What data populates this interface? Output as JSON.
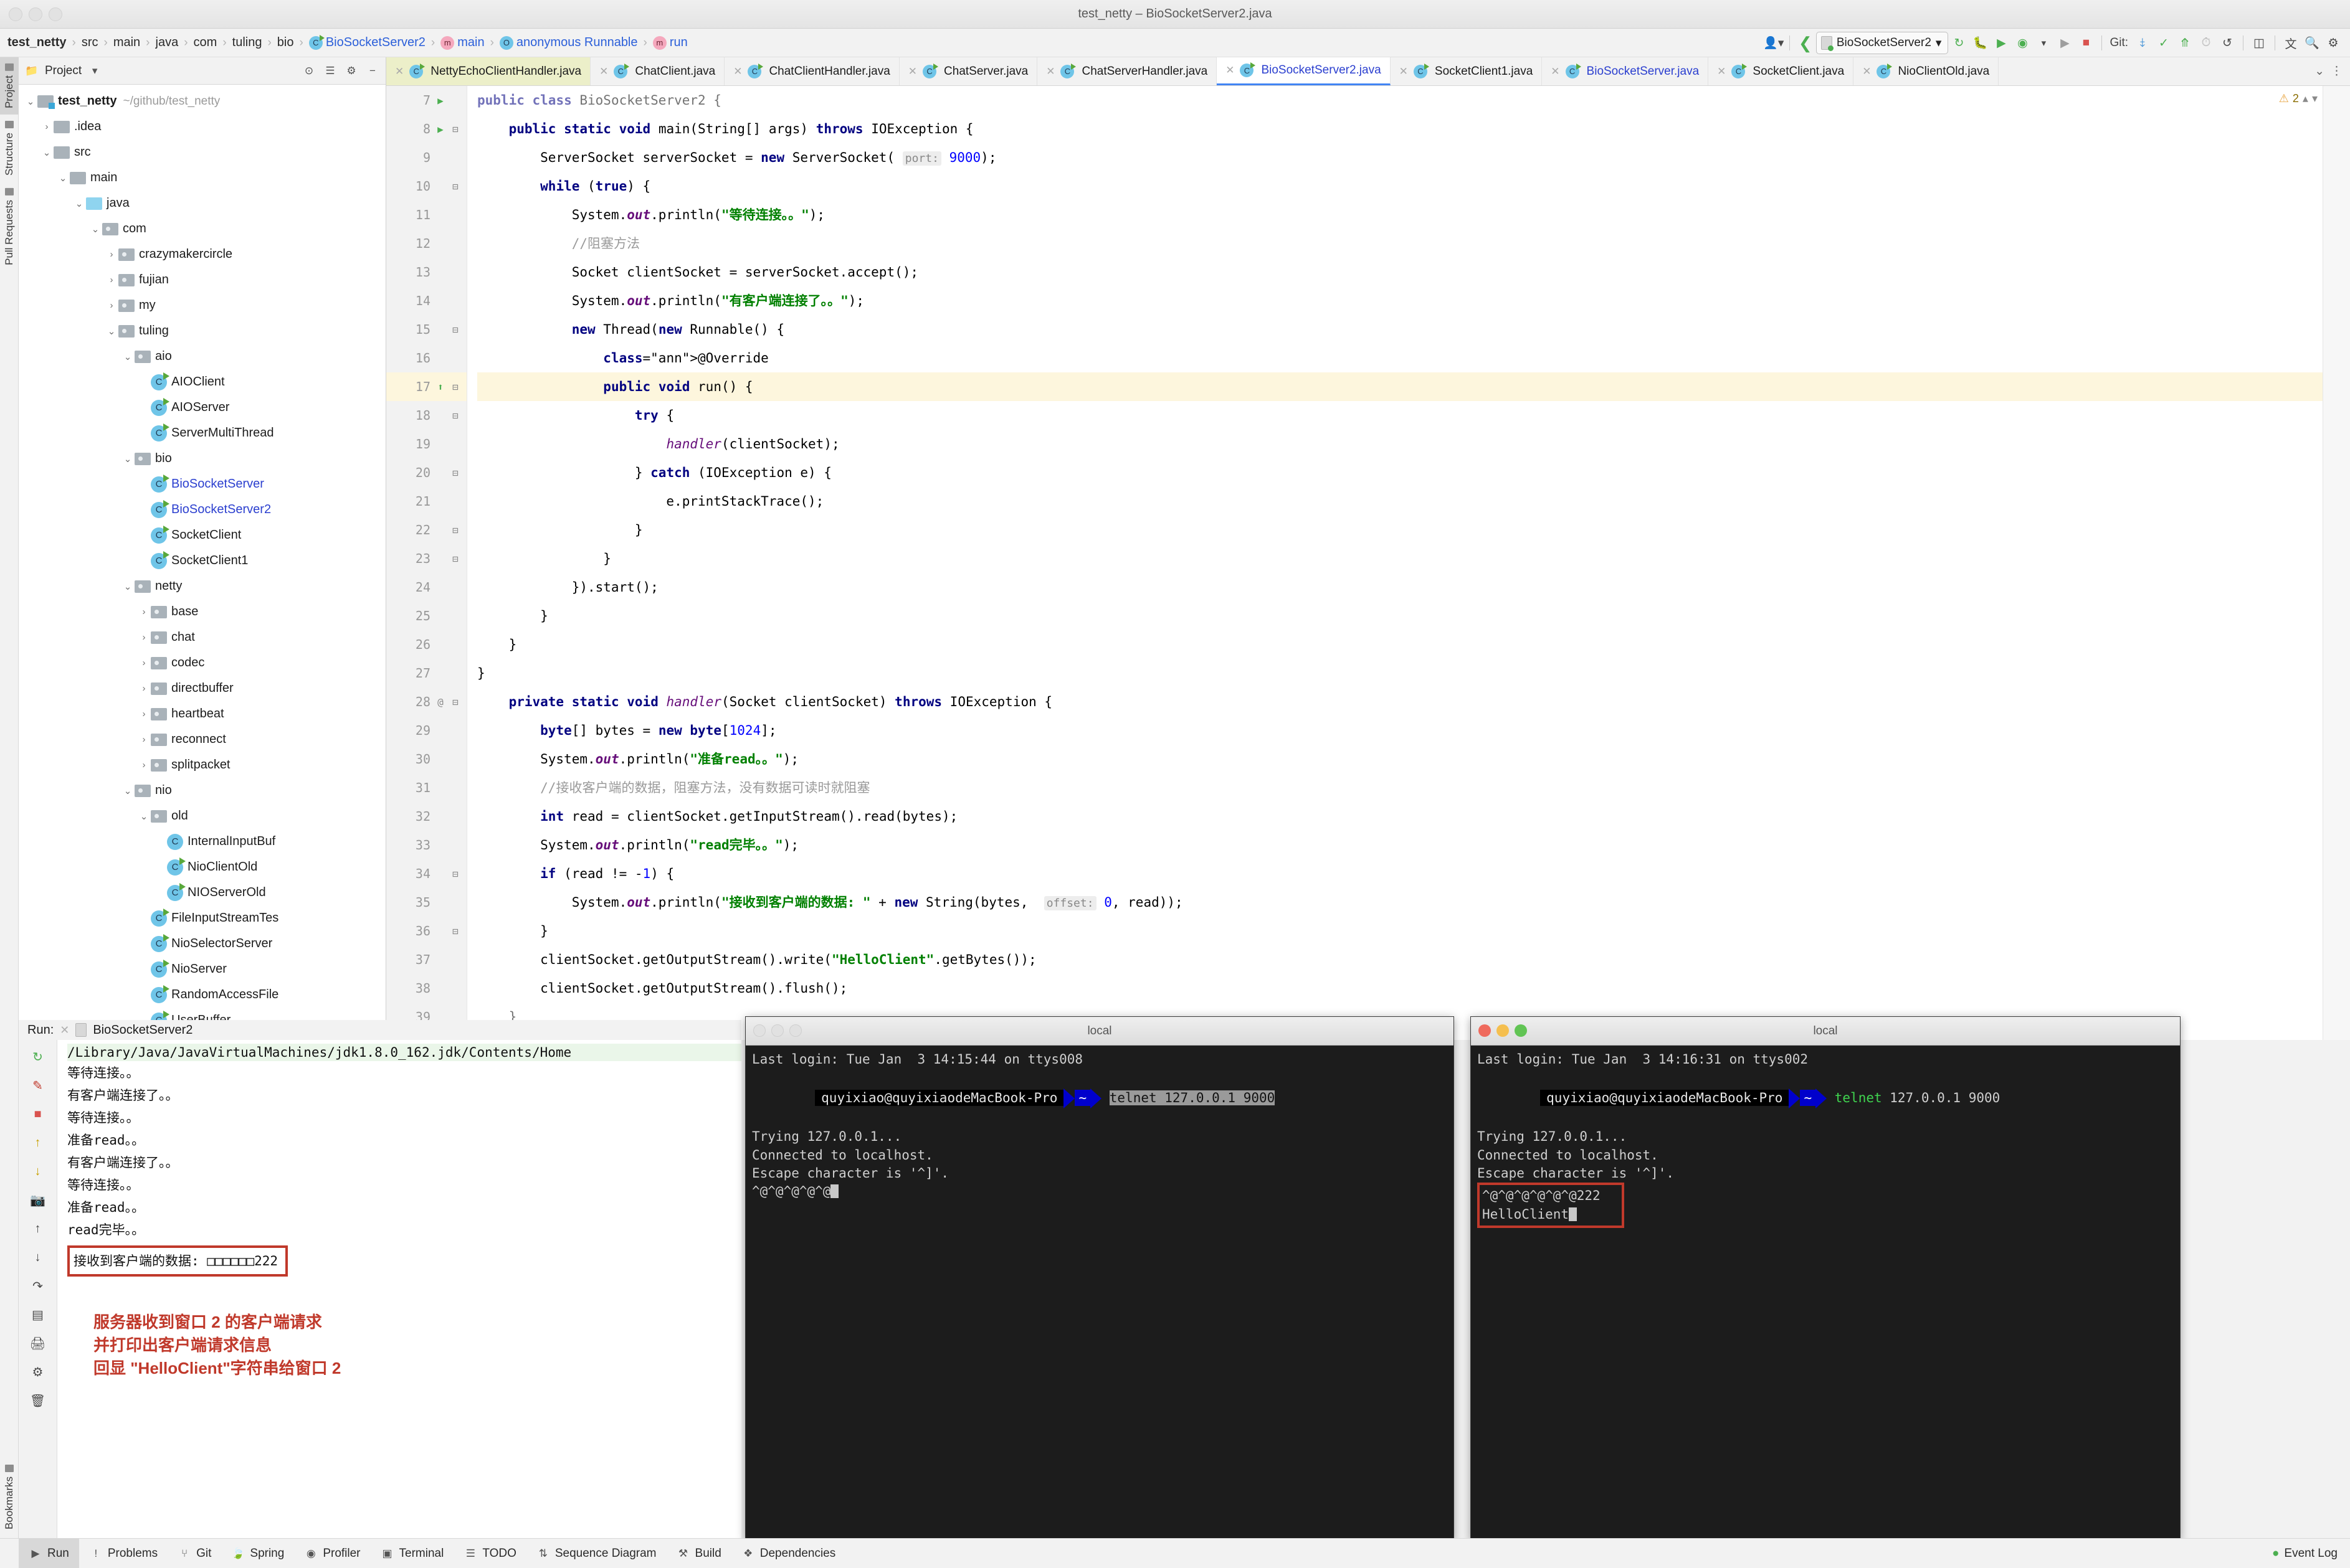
{
  "window": {
    "title": "test_netty – BioSocketServer2.java"
  },
  "breadcrumb": [
    {
      "label": "test_netty",
      "icon": "",
      "style": "bold"
    },
    {
      "label": "src",
      "icon": "",
      "style": ""
    },
    {
      "label": "main",
      "icon": "",
      "style": ""
    },
    {
      "label": "java",
      "icon": "",
      "style": ""
    },
    {
      "label": "com",
      "icon": "",
      "style": ""
    },
    {
      "label": "tuling",
      "icon": "",
      "style": ""
    },
    {
      "label": "bio",
      "icon": "",
      "style": ""
    },
    {
      "label": "BioSocketServer2",
      "icon": "class-icon",
      "style": "blue"
    },
    {
      "label": "main",
      "icon": "method-icon",
      "style": "blue"
    },
    {
      "label": "anonymous Runnable",
      "icon": "object-icon",
      "style": "blue"
    },
    {
      "label": "run",
      "icon": "method-icon",
      "style": "blue"
    }
  ],
  "toolbar": {
    "run_config": "BioSocketServer2",
    "git_label": "Git:",
    "icons": [
      "user-avatar-icon",
      "back-arrow-icon",
      "rerun-icon",
      "debug-icon",
      "coverage-icon",
      "profile-icon",
      "run-icon",
      "stop-icon",
      "git-update-icon",
      "git-commit-icon",
      "git-push-icon",
      "git-history-icon",
      "git-revert-icon",
      "diff-icon",
      "translate-icon",
      "search-icon",
      "settings-icon"
    ]
  },
  "left_strip": [
    {
      "label": "Project",
      "icon": "folder-icon",
      "active": true
    },
    {
      "label": "Structure",
      "icon": "structure-icon",
      "active": false
    },
    {
      "label": "Pull Requests",
      "icon": "pull-request-icon",
      "active": false
    }
  ],
  "bottom_left_strip": [
    {
      "label": "Bookmarks",
      "icon": "bookmark-icon"
    }
  ],
  "project_panel": {
    "title": "Project",
    "header_icons": [
      "collapse-icon",
      "expand-icon",
      "settings-icon",
      "minimize-icon"
    ],
    "tree": [
      {
        "depth": 0,
        "arrow": "down",
        "icon": "module-icon",
        "label": "test_netty",
        "path": "~/github/test_netty",
        "style": "bold"
      },
      {
        "depth": 1,
        "arrow": "right",
        "icon": "folder-icon",
        "label": ".idea",
        "path": "",
        "style": ""
      },
      {
        "depth": 1,
        "arrow": "down",
        "icon": "folder-icon",
        "label": "src",
        "path": "",
        "style": ""
      },
      {
        "depth": 2,
        "arrow": "down",
        "icon": "folder-icon",
        "label": "main",
        "path": "",
        "style": ""
      },
      {
        "depth": 3,
        "arrow": "down",
        "icon": "source-folder-icon",
        "label": "java",
        "path": "",
        "style": ""
      },
      {
        "depth": 4,
        "arrow": "down",
        "icon": "package-icon",
        "label": "com",
        "path": "",
        "style": ""
      },
      {
        "depth": 5,
        "arrow": "right",
        "icon": "package-icon",
        "label": "crazymakercircle",
        "path": "",
        "style": ""
      },
      {
        "depth": 5,
        "arrow": "right",
        "icon": "package-icon",
        "label": "fujian",
        "path": "",
        "style": ""
      },
      {
        "depth": 5,
        "arrow": "right",
        "icon": "package-icon",
        "label": "my",
        "path": "",
        "style": ""
      },
      {
        "depth": 5,
        "arrow": "down",
        "icon": "package-icon",
        "label": "tuling",
        "path": "",
        "style": ""
      },
      {
        "depth": 6,
        "arrow": "down",
        "icon": "package-icon",
        "label": "aio",
        "path": "",
        "style": ""
      },
      {
        "depth": 7,
        "arrow": "none",
        "icon": "class-runnable-icon",
        "label": "AIOClient",
        "path": "",
        "style": ""
      },
      {
        "depth": 7,
        "arrow": "none",
        "icon": "class-runnable-icon",
        "label": "AIOServer",
        "path": "",
        "style": ""
      },
      {
        "depth": 7,
        "arrow": "none",
        "icon": "class-runnable-icon",
        "label": "ServerMultiThread",
        "path": "",
        "style": ""
      },
      {
        "depth": 6,
        "arrow": "down",
        "icon": "package-icon",
        "label": "bio",
        "path": "",
        "style": ""
      },
      {
        "depth": 7,
        "arrow": "none",
        "icon": "class-runnable-icon",
        "label": "BioSocketServer",
        "path": "",
        "style": "blue"
      },
      {
        "depth": 7,
        "arrow": "none",
        "icon": "class-runnable-icon",
        "label": "BioSocketServer2",
        "path": "",
        "style": "blue"
      },
      {
        "depth": 7,
        "arrow": "none",
        "icon": "class-runnable-icon",
        "label": "SocketClient",
        "path": "",
        "style": ""
      },
      {
        "depth": 7,
        "arrow": "none",
        "icon": "class-runnable-icon",
        "label": "SocketClient1",
        "path": "",
        "style": ""
      },
      {
        "depth": 6,
        "arrow": "down",
        "icon": "package-icon",
        "label": "netty",
        "path": "",
        "style": ""
      },
      {
        "depth": 7,
        "arrow": "right",
        "icon": "package-icon",
        "label": "base",
        "path": "",
        "style": ""
      },
      {
        "depth": 7,
        "arrow": "right",
        "icon": "package-icon",
        "label": "chat",
        "path": "",
        "style": ""
      },
      {
        "depth": 7,
        "arrow": "right",
        "icon": "package-icon",
        "label": "codec",
        "path": "",
        "style": ""
      },
      {
        "depth": 7,
        "arrow": "right",
        "icon": "package-icon",
        "label": "directbuffer",
        "path": "",
        "style": ""
      },
      {
        "depth": 7,
        "arrow": "right",
        "icon": "package-icon",
        "label": "heartbeat",
        "path": "",
        "style": ""
      },
      {
        "depth": 7,
        "arrow": "right",
        "icon": "package-icon",
        "label": "reconnect",
        "path": "",
        "style": ""
      },
      {
        "depth": 7,
        "arrow": "right",
        "icon": "package-icon",
        "label": "splitpacket",
        "path": "",
        "style": ""
      },
      {
        "depth": 6,
        "arrow": "down",
        "icon": "package-icon",
        "label": "nio",
        "path": "",
        "style": ""
      },
      {
        "depth": 7,
        "arrow": "down",
        "icon": "package-icon",
        "label": "old",
        "path": "",
        "style": ""
      },
      {
        "depth": 8,
        "arrow": "none",
        "icon": "class-icon",
        "label": "InternalInputBuf",
        "path": "",
        "style": ""
      },
      {
        "depth": 8,
        "arrow": "none",
        "icon": "class-runnable-icon",
        "label": "NioClientOld",
        "path": "",
        "style": ""
      },
      {
        "depth": 8,
        "arrow": "none",
        "icon": "class-runnable-icon",
        "label": "NIOServerOld",
        "path": "",
        "style": ""
      },
      {
        "depth": 7,
        "arrow": "none",
        "icon": "class-runnable-icon",
        "label": "FileInputStreamTes",
        "path": "",
        "style": ""
      },
      {
        "depth": 7,
        "arrow": "none",
        "icon": "class-runnable-icon",
        "label": "NioSelectorServer",
        "path": "",
        "style": ""
      },
      {
        "depth": 7,
        "arrow": "none",
        "icon": "class-runnable-icon",
        "label": "NioServer",
        "path": "",
        "style": ""
      },
      {
        "depth": 7,
        "arrow": "none",
        "icon": "class-runnable-icon",
        "label": "RandomAccessFile",
        "path": "",
        "style": ""
      },
      {
        "depth": 7,
        "arrow": "none",
        "icon": "class-runnable-icon",
        "label": "UserBuffer",
        "path": "",
        "style": ""
      }
    ]
  },
  "editor": {
    "tabs": [
      {
        "label": "NettyEchoClientHandler.java",
        "state": "yellow",
        "icon": "class-icon"
      },
      {
        "label": "ChatClient.java",
        "state": "",
        "icon": "class-runnable-icon"
      },
      {
        "label": "ChatClientHandler.java",
        "state": "",
        "icon": "class-icon"
      },
      {
        "label": "ChatServer.java",
        "state": "",
        "icon": "class-runnable-icon"
      },
      {
        "label": "ChatServerHandler.java",
        "state": "",
        "icon": "class-icon"
      },
      {
        "label": "BioSocketServer2.java",
        "state": "active",
        "icon": "class-runnable-icon"
      },
      {
        "label": "SocketClient1.java",
        "state": "",
        "icon": "class-runnable-icon"
      },
      {
        "label": "BioSocketServer.java",
        "state": "blue",
        "icon": "class-runnable-icon"
      },
      {
        "label": "SocketClient.java",
        "state": "",
        "icon": "class-runnable-icon"
      },
      {
        "label": "NioClientOld.java",
        "state": "",
        "icon": "class-runnable-icon"
      }
    ],
    "inspection_count": "2",
    "lines": [
      {
        "n": 7,
        "marker": "run",
        "fold": "",
        "text": "public class BioSocketServer2 {",
        "partial": true
      },
      {
        "n": 8,
        "marker": "run",
        "fold": "fold",
        "text": "    public static void main(String[] args) throws IOException {"
      },
      {
        "n": 9,
        "marker": "",
        "fold": "",
        "text": "        ServerSocket serverSocket = new ServerSocket( port: 9000);"
      },
      {
        "n": 10,
        "marker": "",
        "fold": "fold",
        "text": "        while (true) {"
      },
      {
        "n": 11,
        "marker": "",
        "fold": "",
        "text": "            System.out.println(\"等待连接。。\");"
      },
      {
        "n": 12,
        "marker": "",
        "fold": "",
        "text": "            //阻塞方法"
      },
      {
        "n": 13,
        "marker": "",
        "fold": "",
        "text": "            Socket clientSocket = serverSocket.accept();"
      },
      {
        "n": 14,
        "marker": "",
        "fold": "",
        "text": "            System.out.println(\"有客户端连接了。。\");"
      },
      {
        "n": 15,
        "marker": "",
        "fold": "fold",
        "text": "            new Thread(new Runnable() {"
      },
      {
        "n": 16,
        "marker": "",
        "fold": "",
        "text": "                @Override"
      },
      {
        "n": 17,
        "marker": "impl",
        "fold": "fold",
        "text": "                public void run() {",
        "highlight": true
      },
      {
        "n": 18,
        "marker": "",
        "fold": "fold",
        "text": "                    try {"
      },
      {
        "n": 19,
        "marker": "",
        "fold": "",
        "text": "                        handler(clientSocket);"
      },
      {
        "n": 20,
        "marker": "",
        "fold": "fold",
        "text": "                    } catch (IOException e) {"
      },
      {
        "n": 21,
        "marker": "",
        "fold": "",
        "text": "                        e.printStackTrace();"
      },
      {
        "n": 22,
        "marker": "",
        "fold": "fold",
        "text": "                    }"
      },
      {
        "n": 23,
        "marker": "",
        "fold": "fold",
        "text": "                }"
      },
      {
        "n": 24,
        "marker": "",
        "fold": "",
        "text": "            }).start();"
      },
      {
        "n": 25,
        "marker": "",
        "fold": "",
        "text": "        }"
      },
      {
        "n": 26,
        "marker": "",
        "fold": "",
        "text": "    }"
      },
      {
        "n": 27,
        "marker": "",
        "fold": "",
        "text": "}"
      },
      {
        "n": 28,
        "marker": "override",
        "fold": "fold",
        "text": "    private static void handler(Socket clientSocket) throws IOException {"
      },
      {
        "n": 29,
        "marker": "",
        "fold": "",
        "text": "        byte[] bytes = new byte[1024];"
      },
      {
        "n": 30,
        "marker": "",
        "fold": "",
        "text": "        System.out.println(\"准备read。。\");"
      },
      {
        "n": 31,
        "marker": "",
        "fold": "",
        "text": "        //接收客户端的数据，阻塞方法，没有数据可读时就阻塞"
      },
      {
        "n": 32,
        "marker": "",
        "fold": "",
        "text": "        int read = clientSocket.getInputStream().read(bytes);"
      },
      {
        "n": 33,
        "marker": "",
        "fold": "",
        "text": "        System.out.println(\"read完毕。。\");"
      },
      {
        "n": 34,
        "marker": "",
        "fold": "fold",
        "text": "        if (read != -1) {"
      },
      {
        "n": 35,
        "marker": "",
        "fold": "",
        "text": "            System.out.println(\"接收到客户端的数据: \" + new String(bytes,  offset: 0, read));"
      },
      {
        "n": 36,
        "marker": "",
        "fold": "fold",
        "text": "        }"
      },
      {
        "n": 37,
        "marker": "",
        "fold": "",
        "text": "        clientSocket.getOutputStream().write(\"HelloClient\".getBytes());"
      },
      {
        "n": 38,
        "marker": "",
        "fold": "",
        "text": "        clientSocket.getOutputStream().flush();"
      },
      {
        "n": 39,
        "marker": "",
        "fold": "",
        "text": "    }",
        "partial": true
      }
    ]
  },
  "run_panel": {
    "label": "Run:",
    "config_name": "BioSocketServer2",
    "toolbar_icons": [
      "rerun-icon",
      "edit-icon",
      "stop-icon",
      "up-arrow-icon",
      "down-arrow-icon",
      "camera-icon",
      "soft-wrap-icon",
      "scroll-end-icon",
      "print-icon",
      "settings-icon",
      "trash-icon"
    ],
    "command_line": "/Library/Java/JavaVirtualMachines/jdk1.8.0_162.jdk/Contents/Home",
    "output": [
      "等待连接。。",
      "有客户端连接了。。",
      "等待连接。。",
      "准备read。。",
      "有客户端连接了。。",
      "等待连接。。",
      "准备read。。",
      "read完毕。。"
    ],
    "highlighted_output": "接收到客户端的数据: □□□□□□222",
    "annotation": [
      "服务器收到窗口 2 的客户端请求",
      "并打印出客户端请求信息",
      "回显 \"HelloClient\"字符串给窗口 2"
    ]
  },
  "terminal1": {
    "title": "local",
    "dots_style": "grey",
    "last_login": "Last login: Tue Jan  3 14:15:44 on ttys008",
    "prompt_user": "quyixiao@quyixiaodeMacBook-Pro",
    "prompt_tilde": "~",
    "command": "telnet 127.0.0.1 9000",
    "command_selected": true,
    "lines": [
      "Trying 127.0.0.1...",
      "Connected to localhost.",
      "Escape character is '^]'."
    ],
    "data_line": "^@^@^@^@^@"
  },
  "terminal2": {
    "title": "local",
    "dots_style": "color",
    "last_login": "Last login: Tue Jan  3 14:16:31 on ttys002",
    "prompt_user": "quyixiao@quyixiaodeMacBook-Pro",
    "prompt_tilde": "~",
    "command_cmd": "telnet",
    "command_args": " 127.0.0.1 9000",
    "lines": [
      "Trying 127.0.0.1...",
      "Connected to localhost.",
      "Escape character is '^]'."
    ],
    "data_line": "^@^@^@^@^@^@222",
    "reply_line": "HelloClient"
  },
  "status_bar": {
    "items": [
      {
        "label": "Run",
        "icon": "run-icon",
        "active": true
      },
      {
        "label": "Problems",
        "icon": "problems-icon",
        "active": false
      },
      {
        "label": "Git",
        "icon": "git-icon",
        "active": false
      },
      {
        "label": "Spring",
        "icon": "spring-icon",
        "active": false
      },
      {
        "label": "Profiler",
        "icon": "profiler-icon",
        "active": false
      },
      {
        "label": "Terminal",
        "icon": "terminal-icon",
        "active": false
      },
      {
        "label": "TODO",
        "icon": "todo-icon",
        "active": false
      },
      {
        "label": "Sequence Diagram",
        "icon": "sequence-diagram-icon",
        "active": false
      },
      {
        "label": "Build",
        "icon": "build-icon",
        "active": false
      },
      {
        "label": "Dependencies",
        "icon": "dependencies-icon",
        "active": false
      }
    ],
    "event_log": "Event Log"
  },
  "colors": {
    "accent_blue": "#2b3fcf",
    "annotation_red": "#c0392b",
    "keyword_navy": "#000080",
    "string_green": "#008000",
    "terminal_bg": "#1c1c1c"
  }
}
